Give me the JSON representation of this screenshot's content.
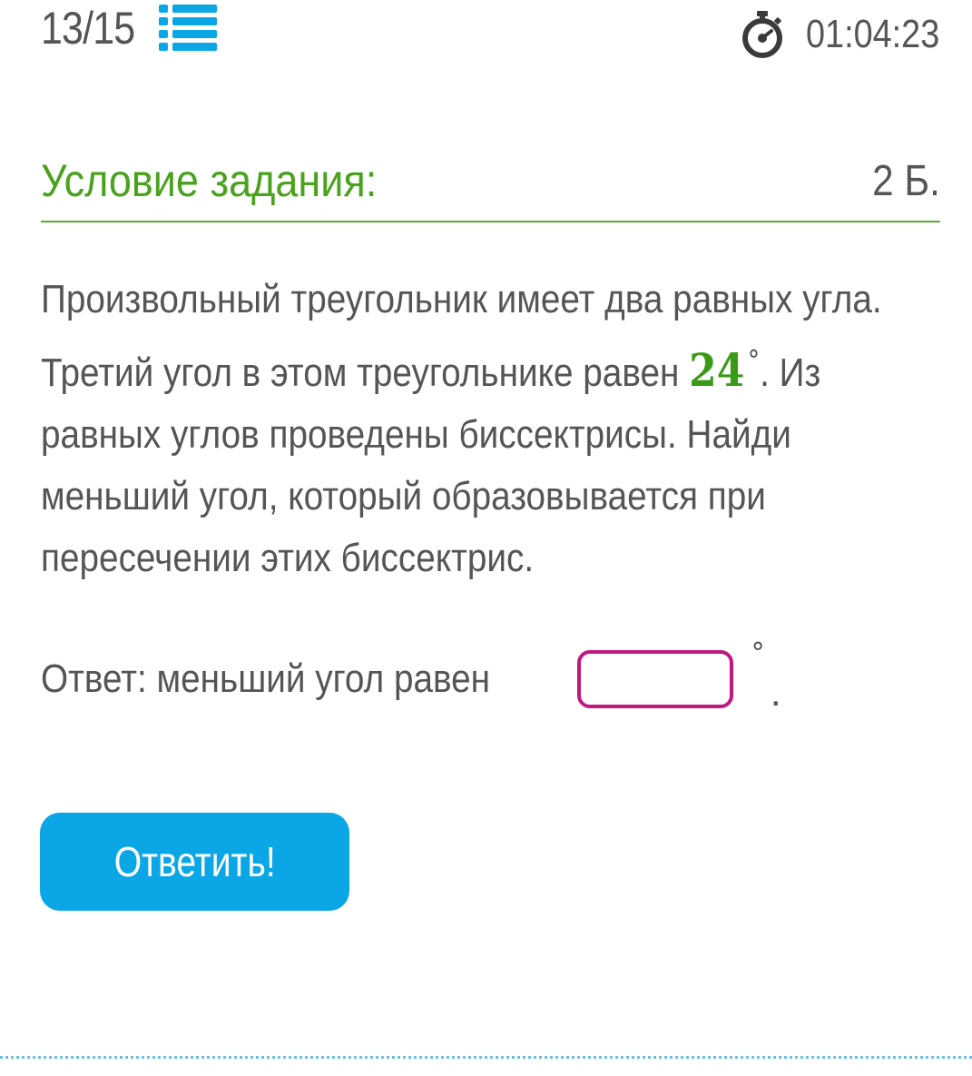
{
  "header": {
    "progress": "13/15",
    "list_icon": "list-icon",
    "timer_icon": "stopwatch-icon",
    "timer": "01:04:23",
    "icon_color": "#0aa6e6"
  },
  "task": {
    "title": "Условие задания:",
    "points": "2 Б.",
    "accent_color": "#4aa21e",
    "text_before": "Произвольный треугольник имеет два равных угла. Третий угол в этом треугольнике равен ",
    "angle_value": "24",
    "angle_degree": "°",
    "text_after": ". Из равных углов проведены биссектрисы. Найди меньший угол, который образовывается при пересечении этих биссектрис."
  },
  "answer": {
    "label": "Ответ: меньший угол равен",
    "input_value": "",
    "input_border_color": "#c0187e",
    "degree": "°",
    "period": "."
  },
  "submit": {
    "label": "Ответить!",
    "color": "#0aa6e6"
  }
}
